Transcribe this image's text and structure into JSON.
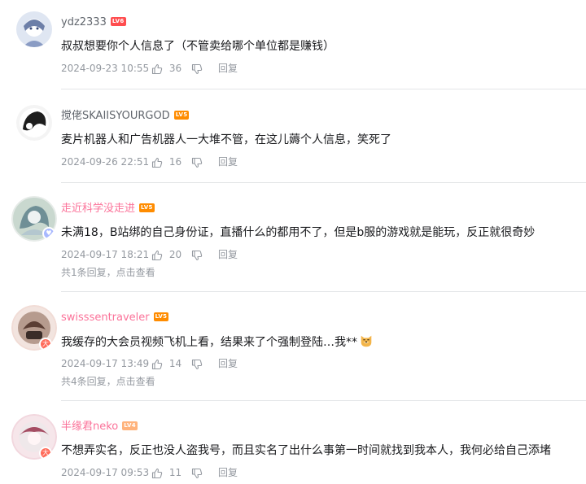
{
  "comments": [
    {
      "username": "ydz2333",
      "level": "LV6",
      "text": "叔叔想要你个人信息了（不管卖给哪个单位都是赚钱）",
      "date": "2024-09-23 10:55",
      "likes": "36",
      "reply_label": "回复"
    },
    {
      "username": "搅佬SKAIISYOURGOD",
      "level": "LV5",
      "text": "麦片机器人和广告机器人一大堆不管，在这儿薅个人信息，笑死了",
      "date": "2024-09-26 22:51",
      "likes": "16",
      "reply_label": "回复"
    },
    {
      "username": "走近科学没走进",
      "level": "LV5",
      "text": "未满18，B站绑的自己身份证，直播什么的都用不了，但是b服的游戏就是能玩，反正就很奇妙",
      "date": "2024-09-17 18:21",
      "likes": "20",
      "reply_label": "回复",
      "replies_summary": "共1条回复，点击查看"
    },
    {
      "username": "swisssentraveler",
      "level": "LV5",
      "text": "我缓存的大会员视频飞机上看，结果来了个强制登陆…我**",
      "date": "2024-09-17 13:49",
      "likes": "14",
      "reply_label": "回复",
      "replies_summary": "共4条回复，点击查看"
    },
    {
      "username": "半缘君neko",
      "level": "LV4",
      "text": "不想弄实名，反正也没人盗我号，而且实名了出什么事第一时间就找到我本人，我何必给自己添堵",
      "date": "2024-09-17 09:53",
      "likes": "11",
      "reply_label": "回复"
    }
  ],
  "colors": {
    "vip_name": "#fb7299",
    "name": "#61666d",
    "meta": "#9499a0",
    "text": "#18191c",
    "divider": "#e3e5e7",
    "lv6": "#ff4d4f",
    "lv5": "#ff8c00",
    "lv4": "#ffb37c"
  },
  "icons": [
    "like-icon",
    "dislike-icon",
    "dog-emoji"
  ]
}
